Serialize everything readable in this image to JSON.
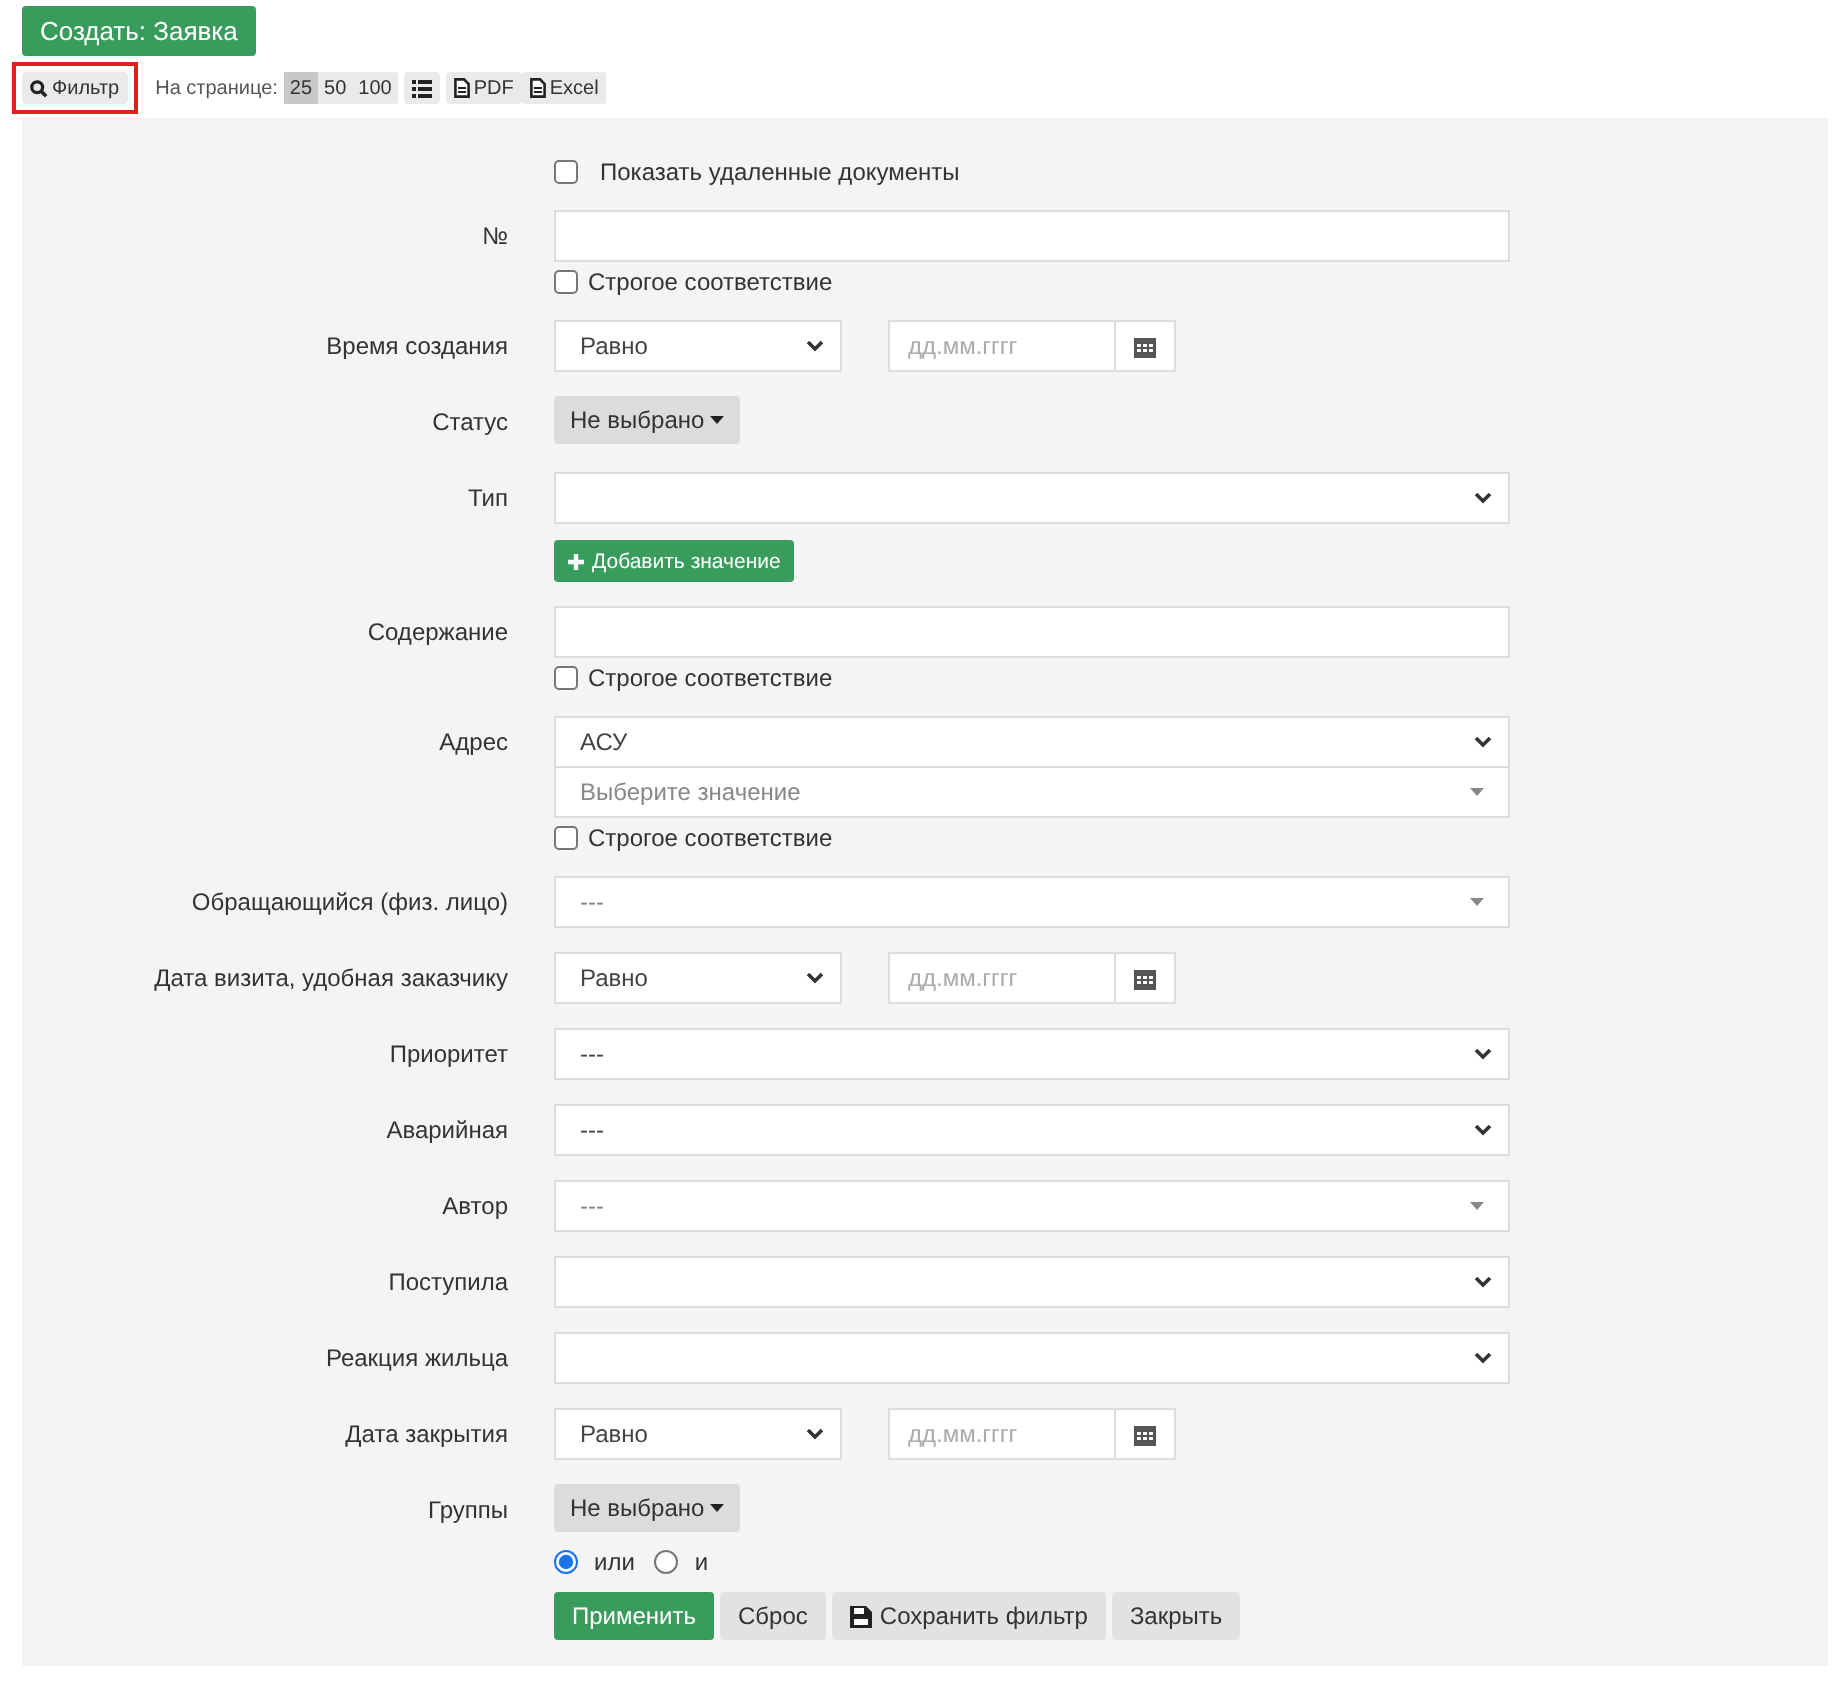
{
  "create_button": "Создать: Заявка",
  "toolbar": {
    "filter_button": {
      "label": "Фильтр",
      "highlighted": true
    },
    "per_page_label": "На странице:",
    "per_page": [
      {
        "label": "25",
        "selected": true
      },
      {
        "label": "50",
        "selected": false
      },
      {
        "label": "100",
        "selected": false
      }
    ],
    "exports": [
      {
        "kind": "list"
      },
      {
        "kind": "file",
        "label": "PDF"
      },
      {
        "kind": "file",
        "label": "Excel"
      }
    ]
  },
  "filter": {
    "fields": [
      {
        "controls": [
          {
            "kind": "checkbox",
            "label": "Показать удаленные документы",
            "checked": false
          }
        ]
      },
      {
        "label": "№",
        "controls": [
          {
            "kind": "text"
          },
          {
            "kind": "checkbox",
            "label": "Строгое соответствие",
            "checked": false
          }
        ]
      },
      {
        "label": "Время создания",
        "controls": [
          {
            "kind": "date",
            "operator": "Равно",
            "placeholder": "дд.мм.гггг"
          }
        ]
      },
      {
        "label": "Статус",
        "controls": [
          {
            "kind": "dropdown",
            "label": "Не выбрано"
          }
        ]
      },
      {
        "label": "Тип",
        "controls": [
          {
            "kind": "select"
          },
          {
            "kind": "add",
            "label": "Добавить значение"
          }
        ]
      },
      {
        "label": "Содержание",
        "controls": [
          {
            "kind": "text"
          },
          {
            "kind": "checkbox",
            "label": "Строгое соответствие",
            "checked": false
          }
        ]
      },
      {
        "label": "Адрес",
        "controls": [
          {
            "kind": "select",
            "value": "АСУ"
          },
          {
            "kind": "combo",
            "placeholder": "Выберите значение"
          },
          {
            "kind": "checkbox",
            "label": "Строгое соответствие",
            "checked": false
          }
        ]
      },
      {
        "label": "Обращающийся (физ. лицо)",
        "controls": [
          {
            "kind": "combo",
            "placeholder": "---"
          }
        ]
      },
      {
        "label": "Дата визита, удобная заказчику",
        "controls": [
          {
            "kind": "date",
            "operator": "Равно",
            "placeholder": "дд.мм.гггг"
          }
        ]
      },
      {
        "label": "Приоритет",
        "controls": [
          {
            "kind": "select",
            "value": "---"
          }
        ]
      },
      {
        "label": "Аварийная",
        "controls": [
          {
            "kind": "select",
            "value": "---"
          }
        ]
      },
      {
        "label": "Автор",
        "controls": [
          {
            "kind": "combo",
            "placeholder": "---"
          }
        ]
      },
      {
        "label": "Поступила",
        "controls": [
          {
            "kind": "select"
          }
        ]
      },
      {
        "label": "Реакция жильца",
        "controls": [
          {
            "kind": "select"
          }
        ]
      },
      {
        "label": "Дата закрытия",
        "controls": [
          {
            "kind": "date",
            "operator": "Равно",
            "placeholder": "дд.мм.гггг"
          }
        ]
      },
      {
        "label": "Группы",
        "controls": [
          {
            "kind": "dropdown",
            "label": "Не выбрано"
          },
          {
            "kind": "radios",
            "options": [
              {
                "label": "или",
                "selected": true
              },
              {
                "label": "и",
                "selected": false
              }
            ]
          }
        ]
      }
    ],
    "actions": [
      {
        "kind": "primary",
        "label": "Применить"
      },
      {
        "kind": "plain",
        "label": "Сброс"
      },
      {
        "kind": "save",
        "label": "Сохранить фильтр"
      },
      {
        "kind": "plain",
        "label": "Закрыть"
      }
    ]
  }
}
